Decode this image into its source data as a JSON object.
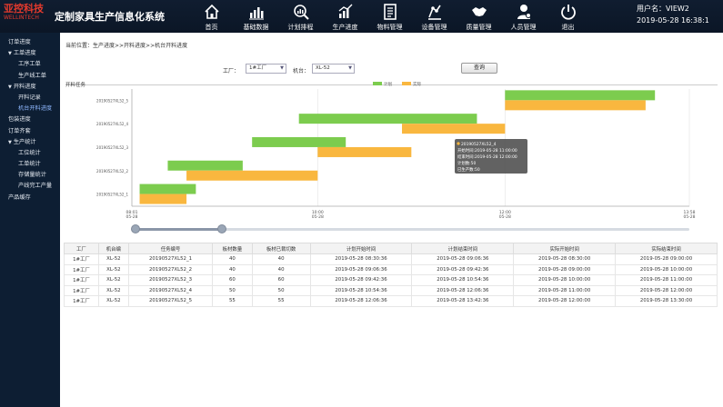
{
  "header": {
    "logo_line1": "亚控科技",
    "logo_line2": "WELLINTECH",
    "title": "定制家具生产信息化系统",
    "user_label": "用户名：",
    "user_name": "VIEW2",
    "datetime": "2019-05-28 16:38:1"
  },
  "nav": [
    {
      "label": "首页",
      "icon": "home-icon"
    },
    {
      "label": "基础数据",
      "icon": "bar-chart-icon"
    },
    {
      "label": "计划排程",
      "icon": "magnifier-chart-icon"
    },
    {
      "label": "生产进度",
      "icon": "progress-chart-icon"
    },
    {
      "label": "物料管理",
      "icon": "document-icon"
    },
    {
      "label": "设备管理",
      "icon": "device-icon"
    },
    {
      "label": "质量管理",
      "icon": "handshake-icon"
    },
    {
      "label": "人员管理",
      "icon": "person-icon"
    },
    {
      "label": "退出",
      "icon": "power-icon"
    }
  ],
  "sidebar": [
    {
      "label": "订单进度",
      "level": 0,
      "arrow": ""
    },
    {
      "label": "工单进度",
      "level": 0,
      "arrow": "▼"
    },
    {
      "label": "工序工单",
      "level": 1,
      "arrow": ""
    },
    {
      "label": "生产线工单",
      "level": 1,
      "arrow": ""
    },
    {
      "label": "开料进度",
      "level": 0,
      "arrow": "▼"
    },
    {
      "label": "开料记录",
      "level": 1,
      "arrow": ""
    },
    {
      "label": "机台开料进度",
      "level": 1,
      "arrow": "",
      "active": true
    },
    {
      "label": "包装进度",
      "level": 0,
      "arrow": ""
    },
    {
      "label": "订单齐套",
      "level": 0,
      "arrow": ""
    },
    {
      "label": "生产统计",
      "level": 0,
      "arrow": "▼"
    },
    {
      "label": "工位统计",
      "level": 1,
      "arrow": ""
    },
    {
      "label": "工单统计",
      "level": 1,
      "arrow": ""
    },
    {
      "label": "存储量统计",
      "level": 1,
      "arrow": ""
    },
    {
      "label": "产线完工产量",
      "level": 1,
      "arrow": ""
    },
    {
      "label": "产品缓存",
      "level": 0,
      "arrow": ""
    }
  ],
  "breadcrumb": "当前位置：生产进度>>开料进度>>机台开料进度",
  "filters": {
    "factory_label": "工厂：",
    "factory_value": "1#工厂",
    "machine_label": "机台：",
    "machine_value": "XL-52",
    "query_label": "查询"
  },
  "chart_data": {
    "type": "gantt",
    "title": "开料任务",
    "legend": [
      {
        "name": "计划",
        "color": "#7ccc4e"
      },
      {
        "name": "实际",
        "color": "#f9b73f"
      }
    ],
    "categories": [
      "20190527XL52_1",
      "20190527XL52_2",
      "20190527XL52_3",
      "20190527XL52_4",
      "20190527XL52_5"
    ],
    "x_ticks": [
      {
        "label": "08:01",
        "date": "05-28",
        "hour": 8.017
      },
      {
        "label": "10:00",
        "date": "05-28",
        "hour": 10
      },
      {
        "label": "12:00",
        "date": "05-28",
        "hour": 12
      },
      {
        "label": "13:58",
        "date": "05-28",
        "hour": 13.967
      }
    ],
    "xlim": [
      8.017,
      13.967
    ],
    "series": [
      {
        "name": "计划",
        "color": "#7ccc4e",
        "bars": [
          {
            "start": 8.1,
            "end": 8.7
          },
          {
            "start": 8.4,
            "end": 9.2
          },
          {
            "start": 9.3,
            "end": 10.3
          },
          {
            "start": 9.8,
            "end": 11.7
          },
          {
            "start": 12.0,
            "end": 13.6
          }
        ]
      },
      {
        "name": "实际",
        "color": "#f9b73f",
        "bars": [
          {
            "start": 8.1,
            "end": 8.6
          },
          {
            "start": 8.6,
            "end": 10.0
          },
          {
            "start": 10.0,
            "end": 11.0
          },
          {
            "start": 10.9,
            "end": 12.0
          },
          {
            "start": 12.0,
            "end": 13.5
          }
        ]
      }
    ],
    "tooltip": {
      "lines": [
        "20190527XL52_4",
        "开始时间:2019-05-28 11:00:00",
        "结束时间:2019-05-28 12:00:00",
        "计划数:50",
        "已生产数:50"
      ]
    }
  },
  "table": {
    "columns": [
      "工厂",
      "机台编",
      "任务编号",
      "板材数量",
      "板材已裁切数",
      "计划开始时间",
      "计划结束时间",
      "实际开始时间",
      "实际结束时间"
    ],
    "rows": [
      [
        "1#工厂",
        "XL-52",
        "20190527XL52_1",
        "40",
        "40",
        "2019-05-28 08:30:36",
        "2019-05-28 09:06:36",
        "2019-05-28 08:30:00",
        "2019-05-28 09:00:00"
      ],
      [
        "1#工厂",
        "XL-52",
        "20190527XL52_2",
        "40",
        "40",
        "2019-05-28 09:06:36",
        "2019-05-28 09:42:36",
        "2019-05-28 09:00:00",
        "2019-05-28 10:00:00"
      ],
      [
        "1#工厂",
        "XL-52",
        "20190527XL52_3",
        "60",
        "60",
        "2019-05-28 09:42:36",
        "2019-05-28 10:54:36",
        "2019-05-28 10:00:00",
        "2019-05-28 11:00:00"
      ],
      [
        "1#工厂",
        "XL-52",
        "20190527XL52_4",
        "50",
        "50",
        "2019-05-28 10:54:36",
        "2019-05-28 12:06:36",
        "2019-05-28 11:00:00",
        "2019-05-28 12:00:00"
      ],
      [
        "1#工厂",
        "XL-52",
        "20190527XL52_5",
        "55",
        "55",
        "2019-05-28 12:06:36",
        "2019-05-28 13:42:36",
        "2019-05-28 12:00:00",
        "2019-05-28 13:30:00"
      ]
    ]
  }
}
